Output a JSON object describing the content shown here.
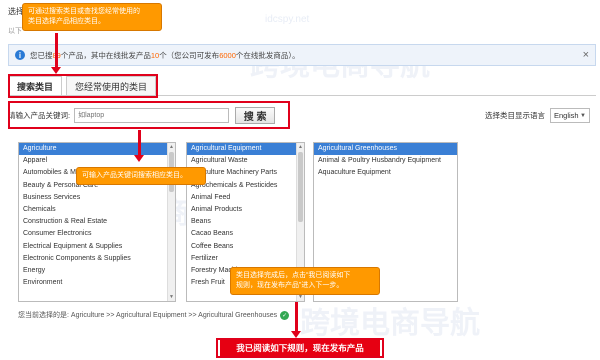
{
  "header": {
    "title": "选择",
    "subtitle": "以下"
  },
  "notice": {
    "pre": "您已搜",
    "count_searched": "89",
    "mid1": "个产品，其中在线批发产品",
    "count_wholesale": "10",
    "mid2": "个（您公司可发布",
    "count_allowed": "6000",
    "post": "个在线批发商品）。"
  },
  "tabs": [
    {
      "label": "搜索类目"
    },
    {
      "label": "您经常使用的类目"
    }
  ],
  "search": {
    "label": "请输入产品关键词:",
    "placeholder": "如laptop",
    "button": "搜 索"
  },
  "language": {
    "label": "选择类目显示语言",
    "selected": "English"
  },
  "lists": {
    "level1": [
      "Agriculture",
      "Apparel",
      "Automobiles & Motorcycles",
      "Beauty & Personal Care",
      "Business Services",
      "Chemicals",
      "Construction & Real Estate",
      "Consumer Electronics",
      "Electrical Equipment & Supplies",
      "Electronic Components & Supplies",
      "Energy",
      "Environment"
    ],
    "level2": [
      "Agricultural Equipment",
      "Agricultural Waste",
      "Agriculture Machinery Parts",
      "Agrochemicals & Pesticides",
      "Animal Feed",
      "Animal Products",
      "Beans",
      "Cacao Beans",
      "Coffee Beans",
      "Fertilizer",
      "Forestry Machinery",
      "Fresh Fruit"
    ],
    "level3": [
      "Agricultural Greenhouses",
      "Animal & Poultry Husbandry Equipment",
      "Aquaculture Equipment"
    ]
  },
  "path": {
    "label": "您当前选择的是:",
    "value": "Agriculture >> Agricultural Equipment >> Agricultural Greenhouses"
  },
  "submit": {
    "label": "我已阅读如下规则，现在发布产品"
  },
  "tips": {
    "tip1_line1": "可通过搜索类目或查找您经常使用的",
    "tip1_line2": "类目选择产品相应类目。",
    "tip2": "可输入产品关键词搜索相应类目。",
    "tip3_line1": "类目选择完成后，点击“我已阅读如下",
    "tip3_line2": "规则，现在发布产品”进入下一步。"
  },
  "watermark": {
    "brand": "跨境电商导航",
    "domain": "idcspy.net"
  },
  "colors": {
    "accent_red": "#e0001b",
    "tip_orange": "#ff9900",
    "select_blue": "#3a7fd5",
    "number_orange": "#ff6600"
  }
}
